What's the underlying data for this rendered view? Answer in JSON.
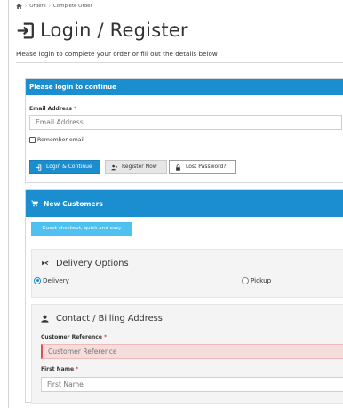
{
  "breadcrumb": {
    "home_icon": "home-icon",
    "separator": "›",
    "items": [
      "Orders",
      "Complete Order"
    ]
  },
  "page": {
    "title": "Login / Register",
    "title_icon": "sign-in-icon",
    "subtitle": "Please login to complete your order or fill out the details below"
  },
  "login": {
    "header": "Please login to continue",
    "email_label": "Email Address",
    "required_mark": "*",
    "email_placeholder": "Email Address",
    "remember_label": "Remember email",
    "remember_checked": false,
    "login_button": "Login & Continue",
    "register_button": "Register Now",
    "lost_password_button": "Lost Password?"
  },
  "new_customers": {
    "header": "New Customers",
    "header_icon": "cart-icon",
    "guest_button": "Guest checkout, quick and easy",
    "delivery": {
      "title": "Delivery Options",
      "title_icon": "truck-icon",
      "options": [
        {
          "label": "Delivery",
          "selected": true
        },
        {
          "label": "Pickup",
          "selected": false
        }
      ]
    },
    "contact": {
      "title": "Contact / Billing Address",
      "title_icon": "user-icon",
      "customer_reference_label": "Customer Reference",
      "customer_reference_placeholder": "Customer Reference",
      "first_name_label": "First Name",
      "first_name_placeholder": "First Name"
    }
  },
  "colors": {
    "accent": "#1b8ecf",
    "guest_button": "#4fc1f0",
    "required": "#d9534f",
    "invalid_field": "#f7dcdc"
  }
}
